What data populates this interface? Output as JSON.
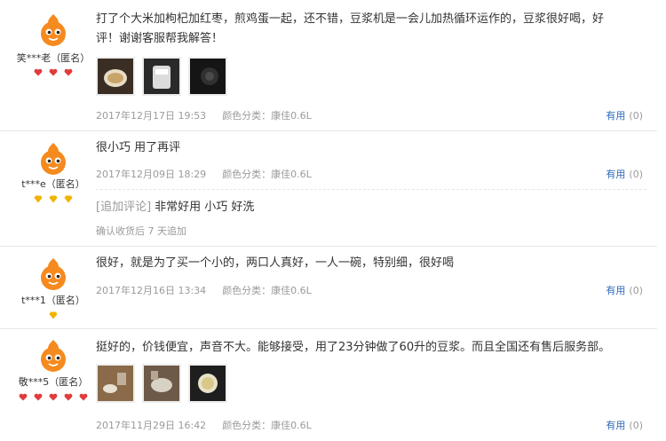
{
  "colors": {
    "avatar_orange": "#f58a1f",
    "heart_red": "#e03c3c",
    "diamond_gold": "#f0b400",
    "useful_blue": "#2b6ab8",
    "meta_gray": "#9a9a9a"
  },
  "reviews": [
    {
      "user": "笑***老（匿名）",
      "badge_type": "heart",
      "badge_count": 3,
      "text_line1": "打了个大米加枸杞加红枣，煎鸡蛋一起，还不错，豆浆机是一会儿加热循环运作的，豆浆很好喝，好",
      "text_line2": "评！谢谢客服帮我解答！",
      "photos": [
        "photo-soymilk-cup",
        "photo-soymilk-machine",
        "photo-dark-interior"
      ],
      "date": "2017年12月17日 19:53",
      "color_label": "颜色分类：康佳0.6L",
      "useful_label": "有用",
      "useful_count": "(0)"
    },
    {
      "user": "t***e（匿名）",
      "badge_type": "diamond",
      "badge_count": 3,
      "text_line1": "很小巧 用了再评",
      "date": "2017年12月09日 18:29",
      "color_label": "颜色分类：康佳0.6L",
      "useful_label": "有用",
      "useful_count": "(0)",
      "append_tag": "[追加评论]",
      "append_text": "非常好用 小巧 好洗",
      "append_time": "确认收货后 7 天追加"
    },
    {
      "user": "t***1（匿名）",
      "badge_type": "diamond",
      "badge_count": 1,
      "text_line1": "很好，就是为了买一个小的，两口人真好，一人一碗，特别细，很好喝",
      "date": "2017年12月16日 13:34",
      "color_label": "颜色分类：康佳0.6L",
      "useful_label": "有用",
      "useful_count": "(0)"
    },
    {
      "user": "敬***5（匿名）",
      "badge_type": "heart",
      "badge_count": 5,
      "text_line1": "挺好的，价钱便宜，声音不大。能够接受，用了23分钟做了60升的豆浆。而且全国还有售后服务部。",
      "photos": [
        "photo-table-top",
        "photo-cooking",
        "photo-bowl"
      ],
      "date": "2017年11月29日 16:42",
      "color_label": "颜色分类：康佳0.6L",
      "useful_label": "有用",
      "useful_count": "(0)"
    }
  ]
}
